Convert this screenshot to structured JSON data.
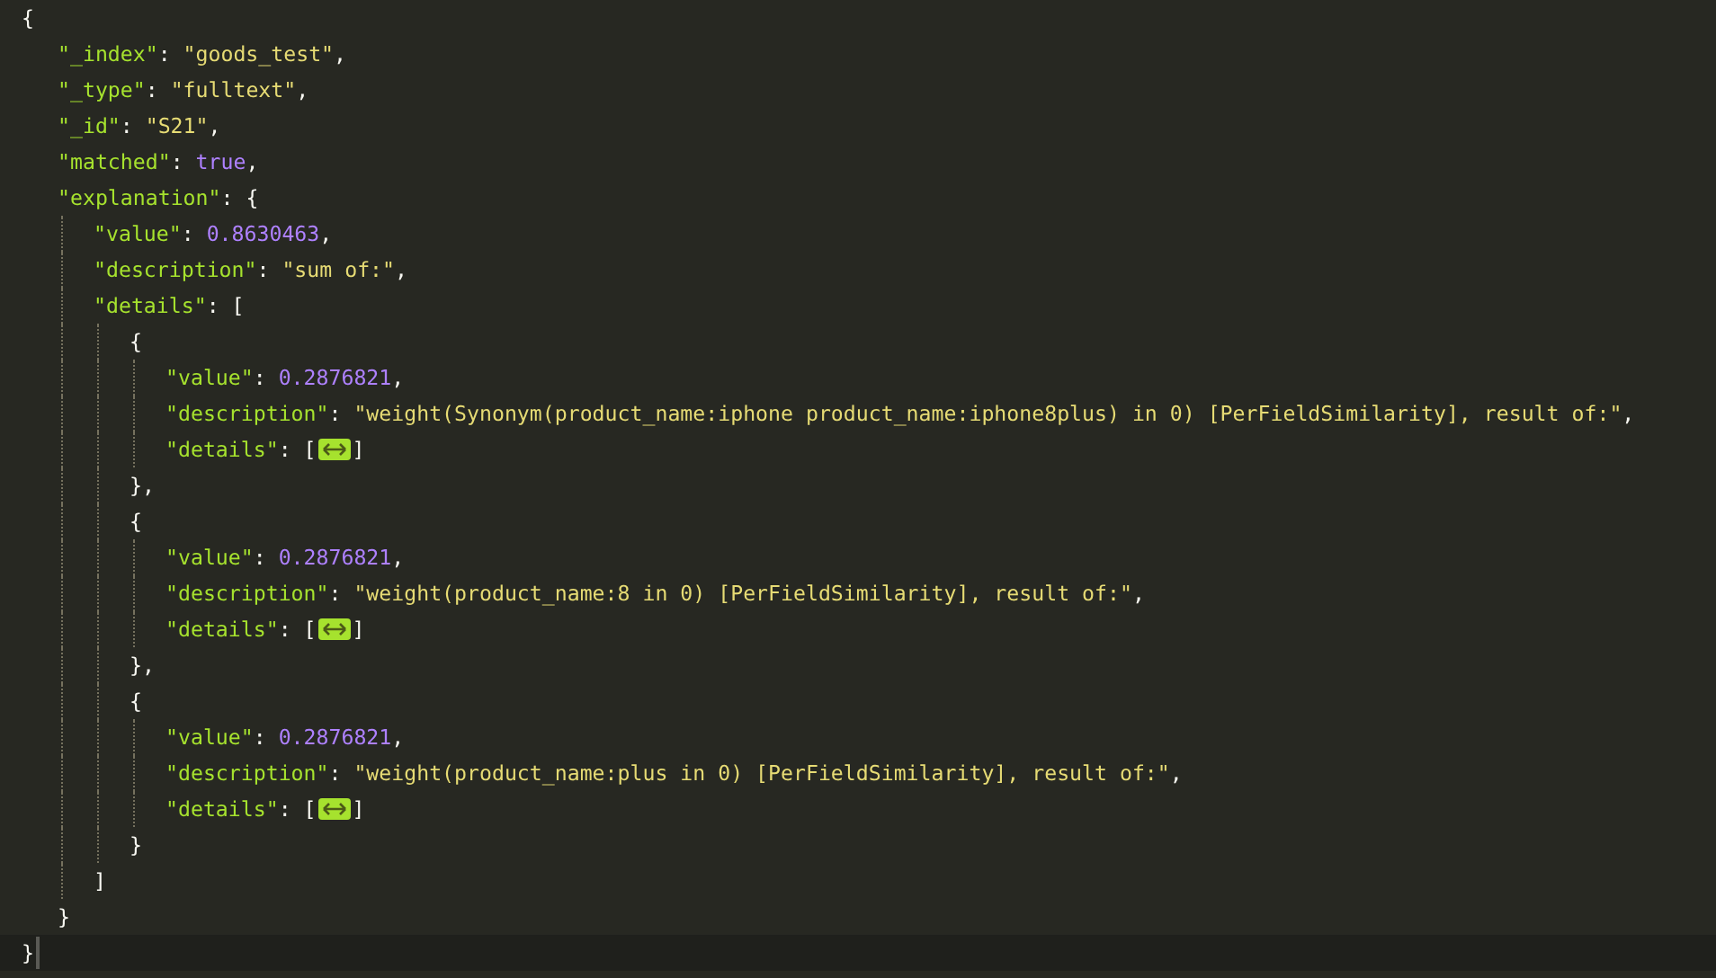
{
  "editor": {
    "root": {
      "open": [
        {
          "kind": "punct",
          "text": "{"
        }
      ],
      "cursor_on_close": true,
      "close": [
        {
          "kind": "punct",
          "text": "}"
        }
      ],
      "children": [
        {
          "open": [
            {
              "kind": "key",
              "text": "\"_index\""
            },
            {
              "kind": "colon",
              "text": ":"
            },
            {
              "kind": "string",
              "text": "\"goods_test\""
            },
            {
              "kind": "punct",
              "text": ","
            }
          ]
        },
        {
          "open": [
            {
              "kind": "key",
              "text": "\"_type\""
            },
            {
              "kind": "colon",
              "text": ":"
            },
            {
              "kind": "string",
              "text": "\"fulltext\""
            },
            {
              "kind": "punct",
              "text": ","
            }
          ]
        },
        {
          "open": [
            {
              "kind": "key",
              "text": "\"_id\""
            },
            {
              "kind": "colon",
              "text": ":"
            },
            {
              "kind": "string",
              "text": "\"S21\""
            },
            {
              "kind": "punct",
              "text": ","
            }
          ]
        },
        {
          "open": [
            {
              "kind": "key",
              "text": "\"matched\""
            },
            {
              "kind": "colon",
              "text": ":"
            },
            {
              "kind": "boolean",
              "text": "true"
            },
            {
              "kind": "punct",
              "text": ","
            }
          ]
        },
        {
          "open": [
            {
              "kind": "key",
              "text": "\"explanation\""
            },
            {
              "kind": "colon",
              "text": ":"
            },
            {
              "kind": "punct",
              "text": "{"
            }
          ],
          "close": [
            {
              "kind": "punct",
              "text": "}"
            }
          ],
          "children": [
            {
              "open": [
                {
                  "kind": "key",
                  "text": "\"value\""
                },
                {
                  "kind": "colon",
                  "text": ":"
                },
                {
                  "kind": "number",
                  "text": "0.8630463"
                },
                {
                  "kind": "punct",
                  "text": ","
                }
              ]
            },
            {
              "open": [
                {
                  "kind": "key",
                  "text": "\"description\""
                },
                {
                  "kind": "colon",
                  "text": ":"
                },
                {
                  "kind": "string",
                  "text": "\"sum of:\""
                },
                {
                  "kind": "punct",
                  "text": ","
                }
              ]
            },
            {
              "open": [
                {
                  "kind": "key",
                  "text": "\"details\""
                },
                {
                  "kind": "colon",
                  "text": ":"
                },
                {
                  "kind": "punct",
                  "text": "["
                }
              ],
              "close": [
                {
                  "kind": "punct",
                  "text": "]"
                }
              ],
              "children": [
                {
                  "open": [
                    {
                      "kind": "punct",
                      "text": "{"
                    }
                  ],
                  "close": [
                    {
                      "kind": "punct",
                      "text": "}"
                    },
                    {
                      "kind": "punct",
                      "text": ","
                    }
                  ],
                  "children": [
                    {
                      "open": [
                        {
                          "kind": "key",
                          "text": "\"value\""
                        },
                        {
                          "kind": "colon",
                          "text": ":"
                        },
                        {
                          "kind": "number",
                          "text": "0.2876821"
                        },
                        {
                          "kind": "punct",
                          "text": ","
                        }
                      ]
                    },
                    {
                      "open": [
                        {
                          "kind": "key",
                          "text": "\"description\""
                        },
                        {
                          "kind": "colon",
                          "text": ":"
                        },
                        {
                          "kind": "string",
                          "text": "\"weight(Synonym(product_name:iphone product_name:iphone8plus) in 0) [PerFieldSimilarity], result of:\""
                        },
                        {
                          "kind": "punct",
                          "text": ","
                        }
                      ]
                    },
                    {
                      "open": [
                        {
                          "kind": "key",
                          "text": "\"details\""
                        },
                        {
                          "kind": "colon",
                          "text": ":"
                        },
                        {
                          "kind": "punct",
                          "text": "["
                        },
                        {
                          "kind": "fold"
                        },
                        {
                          "kind": "punct",
                          "text": "]"
                        }
                      ]
                    }
                  ]
                },
                {
                  "open": [
                    {
                      "kind": "punct",
                      "text": "{"
                    }
                  ],
                  "close": [
                    {
                      "kind": "punct",
                      "text": "}"
                    },
                    {
                      "kind": "punct",
                      "text": ","
                    }
                  ],
                  "children": [
                    {
                      "open": [
                        {
                          "kind": "key",
                          "text": "\"value\""
                        },
                        {
                          "kind": "colon",
                          "text": ":"
                        },
                        {
                          "kind": "number",
                          "text": "0.2876821"
                        },
                        {
                          "kind": "punct",
                          "text": ","
                        }
                      ]
                    },
                    {
                      "open": [
                        {
                          "kind": "key",
                          "text": "\"description\""
                        },
                        {
                          "kind": "colon",
                          "text": ":"
                        },
                        {
                          "kind": "string",
                          "text": "\"weight(product_name:8 in 0) [PerFieldSimilarity], result of:\""
                        },
                        {
                          "kind": "punct",
                          "text": ","
                        }
                      ]
                    },
                    {
                      "open": [
                        {
                          "kind": "key",
                          "text": "\"details\""
                        },
                        {
                          "kind": "colon",
                          "text": ":"
                        },
                        {
                          "kind": "punct",
                          "text": "["
                        },
                        {
                          "kind": "fold"
                        },
                        {
                          "kind": "punct",
                          "text": "]"
                        }
                      ]
                    }
                  ]
                },
                {
                  "open": [
                    {
                      "kind": "punct",
                      "text": "{"
                    }
                  ],
                  "close": [
                    {
                      "kind": "punct",
                      "text": "}"
                    }
                  ],
                  "children": [
                    {
                      "open": [
                        {
                          "kind": "key",
                          "text": "\"value\""
                        },
                        {
                          "kind": "colon",
                          "text": ":"
                        },
                        {
                          "kind": "number",
                          "text": "0.2876821"
                        },
                        {
                          "kind": "punct",
                          "text": ","
                        }
                      ]
                    },
                    {
                      "open": [
                        {
                          "kind": "key",
                          "text": "\"description\""
                        },
                        {
                          "kind": "colon",
                          "text": ":"
                        },
                        {
                          "kind": "string",
                          "text": "\"weight(product_name:plus in 0) [PerFieldSimilarity], result of:\""
                        },
                        {
                          "kind": "punct",
                          "text": ","
                        }
                      ]
                    },
                    {
                      "open": [
                        {
                          "kind": "key",
                          "text": "\"details\""
                        },
                        {
                          "kind": "colon",
                          "text": ":"
                        },
                        {
                          "kind": "punct",
                          "text": "["
                        },
                        {
                          "kind": "fold"
                        },
                        {
                          "kind": "punct",
                          "text": "]"
                        }
                      ]
                    }
                  ]
                }
              ]
            }
          ]
        }
      ]
    }
  }
}
